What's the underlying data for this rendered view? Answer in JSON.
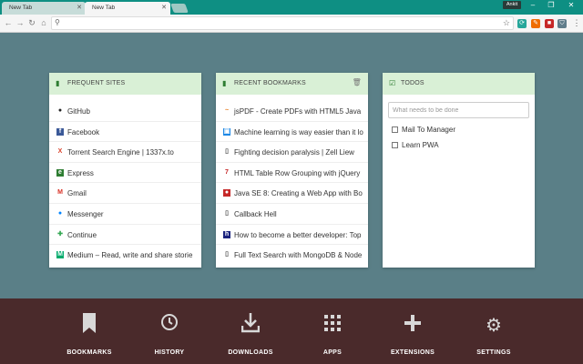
{
  "browser": {
    "tabs": [
      {
        "label": "New Tab"
      },
      {
        "label": "New Tab"
      }
    ],
    "user_badge": "Ankit",
    "address": {
      "value": "",
      "placeholder": ""
    }
  },
  "frequent_sites": {
    "title": "FREQUENT SITES",
    "items": [
      {
        "label": "GitHub",
        "icon": "github-icon",
        "color": "#222222"
      },
      {
        "label": "Facebook",
        "icon": "facebook-icon",
        "color": "#3b5998"
      },
      {
        "label": "Torrent Search Engine | 1337x.to",
        "icon": "1337x-icon",
        "color": "#d9422b"
      },
      {
        "label": "Express",
        "icon": "express-icon",
        "color": "#2e7d32"
      },
      {
        "label": "Gmail",
        "icon": "gmail-icon",
        "color": "#d93025"
      },
      {
        "label": "Messenger",
        "icon": "messenger-icon",
        "color": "#0084ff"
      },
      {
        "label": "Continue",
        "icon": "continue-icon",
        "color": "#34a853"
      },
      {
        "label": "Medium – Read, write and share storie",
        "icon": "medium-icon",
        "color": "#00ab6c"
      }
    ]
  },
  "recent_bookmarks": {
    "title": "RECENT BOOKMARKS",
    "items": [
      {
        "label": "jsPDF - Create PDFs with HTML5 Java",
        "icon": "jspdf-icon",
        "color": "#e67e22"
      },
      {
        "label": "Machine learning is way easier than it lo",
        "icon": "medium-icon",
        "color": "#1e88e5"
      },
      {
        "label": "Fighting decision paralysis | Zell Liew",
        "icon": "page-icon",
        "color": "#555555"
      },
      {
        "label": "HTML Table Row Grouping with jQuery",
        "icon": "bookmark-7-icon",
        "color": "#c62828"
      },
      {
        "label": "Java SE 8: Creating a Web App with Bo",
        "icon": "oracle-icon",
        "color": "#c62828"
      },
      {
        "label": "Callback Hell",
        "icon": "page-icon",
        "color": "#555555"
      },
      {
        "label": "How to become a better developer: Top",
        "icon": "hashnode-icon",
        "color": "#1a237e"
      },
      {
        "label": "Full Text Search with MongoDB & Node",
        "icon": "page-icon",
        "color": "#555555"
      }
    ]
  },
  "todos": {
    "title": "TODOS",
    "input_placeholder": "What needs to be done",
    "items": [
      {
        "label": "Mail To Manager"
      },
      {
        "label": "Learn PWA"
      }
    ]
  },
  "footer": {
    "items": [
      {
        "label": "BOOKMARKS",
        "icon": "bookmark-icon"
      },
      {
        "label": "HISTORY",
        "icon": "clock-icon"
      },
      {
        "label": "DOWNLOADS",
        "icon": "download-icon"
      },
      {
        "label": "APPS",
        "icon": "apps-grid-icon"
      },
      {
        "label": "EXTENSIONS",
        "icon": "plus-icon"
      },
      {
        "label": "SETTINGS",
        "icon": "gear-icon"
      }
    ]
  },
  "colors": {
    "titlebar": "#0e8f83",
    "page_bg": "#5a7f87",
    "card_header": "#d9f0d6",
    "footer_bg": "#4a2a2b"
  }
}
